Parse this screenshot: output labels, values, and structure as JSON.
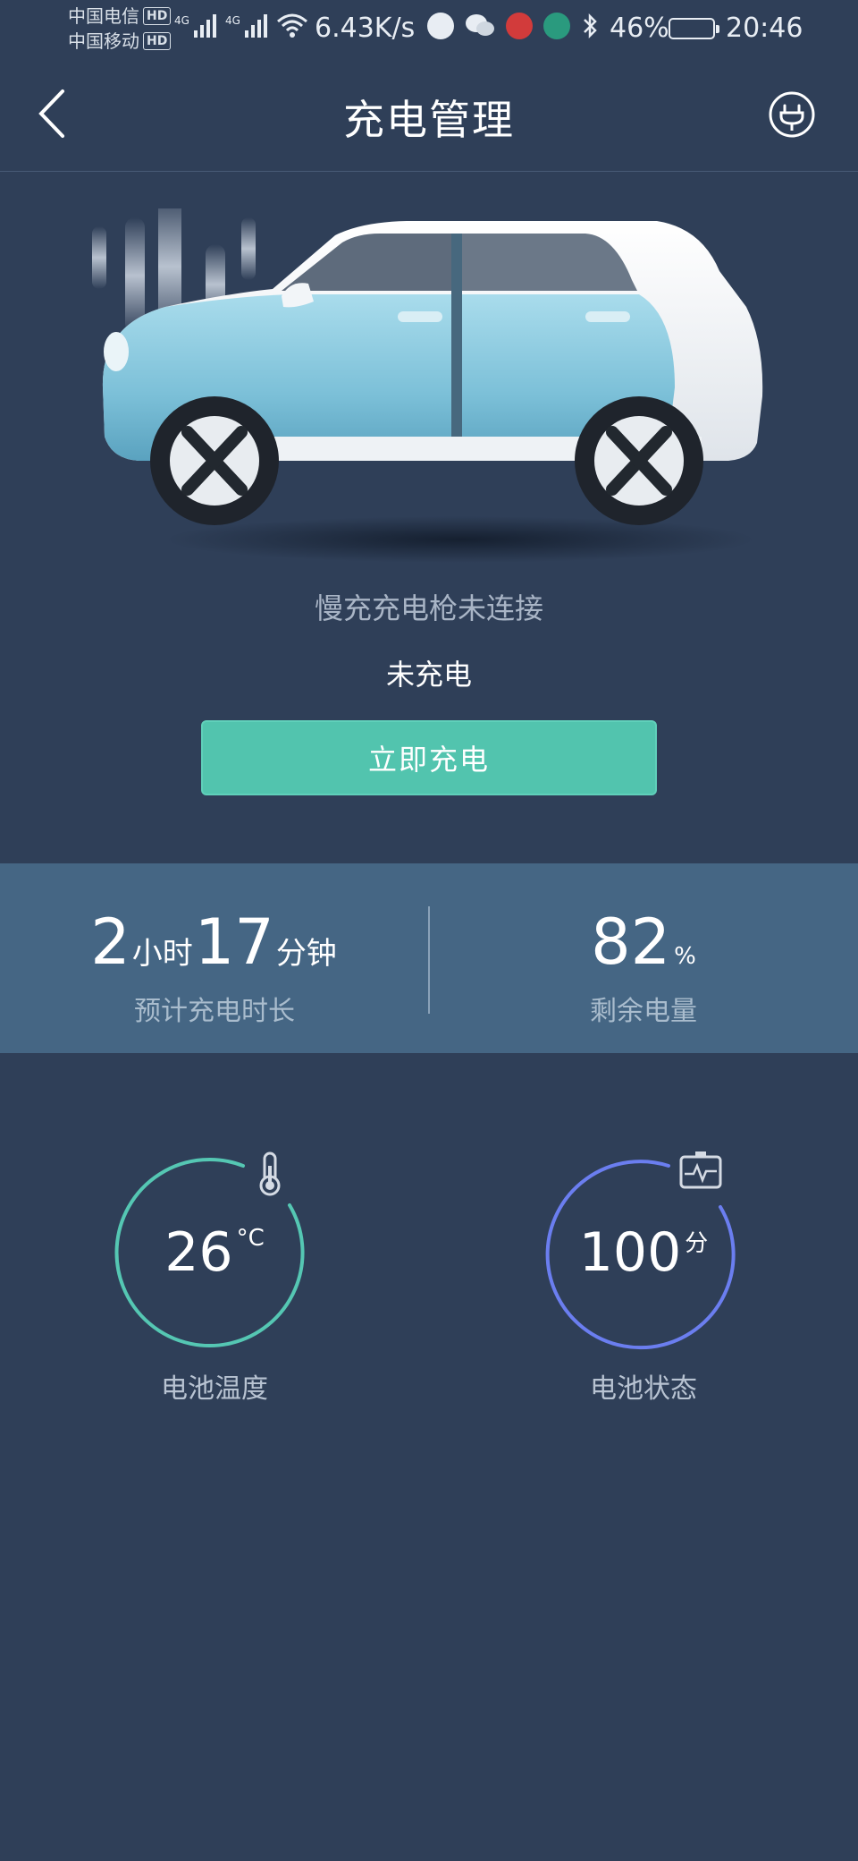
{
  "status_bar": {
    "carrier1": "中国电信",
    "carrier2": "中国移动",
    "hd_label": "HD",
    "network_label": "4G",
    "speed": "6.43K/s",
    "battery_percent": "46%",
    "time": "20:46"
  },
  "header": {
    "title": "充电管理"
  },
  "charging": {
    "gun_status": "慢充充电枪未连接",
    "state": "未充电",
    "charge_button_label": "立即充电"
  },
  "stats": {
    "hours": "2",
    "hours_unit": "小时",
    "minutes": "17",
    "minutes_unit": "分钟",
    "duration_label": "预计充电时长",
    "remaining_value": "82",
    "remaining_unit": "%",
    "remaining_label": "剩余电量"
  },
  "battery": {
    "temperature_value": "26",
    "temperature_unit": "°C",
    "temperature_label": "电池温度",
    "health_value": "100",
    "health_unit": "分",
    "health_label": "电池状态"
  },
  "colors": {
    "background": "#2f3f58",
    "accent_green": "#52c4ae",
    "stats_band": "#456684",
    "temp_ring": "#55c7b3",
    "health_ring": "#6b7ef0"
  },
  "icons": {
    "back": "chevron-left-icon",
    "plug": "plug-icon",
    "thermometer": "thermometer-icon",
    "battery_monitor": "battery-pulse-icon"
  }
}
